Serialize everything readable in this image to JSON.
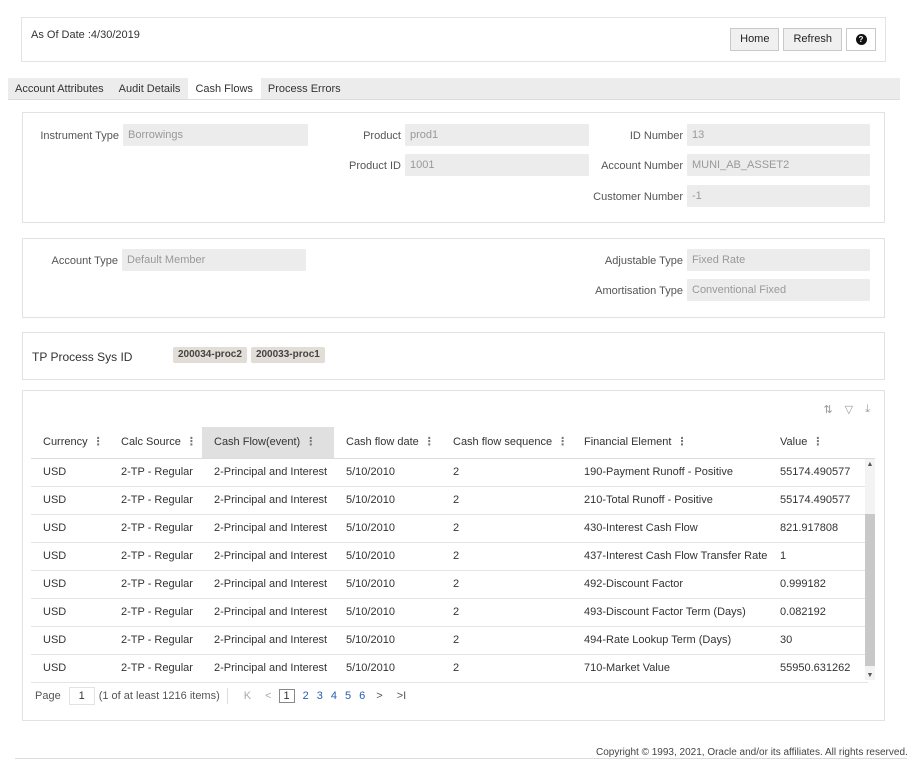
{
  "header": {
    "as_of": "As Of Date :4/30/2019",
    "home": "Home",
    "refresh": "Refresh",
    "help_glyph": "?"
  },
  "tabs": [
    {
      "label": "Account Attributes"
    },
    {
      "label": "Audit Details"
    },
    {
      "label": "Cash Flows"
    },
    {
      "label": "Process Errors"
    }
  ],
  "active_tab": "Cash Flows",
  "panel1": {
    "instrument_type_label": "Instrument Type",
    "instrument_type": "Borrowings",
    "product_label": "Product",
    "product": "prod1",
    "product_id_label": "Product ID",
    "product_id": "1001",
    "id_number_label": "ID Number",
    "id_number": "13",
    "account_number_label": "Account Number",
    "account_number": "MUNI_AB_ASSET2",
    "customer_number_label": "Customer Number",
    "customer_number": "-1"
  },
  "panel2": {
    "account_type_label": "Account Type",
    "account_type": "Default Member",
    "adjustable_type_label": "Adjustable Type",
    "adjustable_type": "Fixed Rate",
    "amortisation_type_label": "Amortisation Type",
    "amortisation_type": "Conventional Fixed"
  },
  "tp": {
    "label": "TP Process Sys ID",
    "chips": [
      "200034-proc2",
      "200033-proc1"
    ]
  },
  "grid": {
    "toolbar_icons": [
      "sort-icon",
      "filter-icon",
      "download-icon"
    ],
    "columns": [
      "Currency",
      "Calc Source",
      "Cash Flow(event)",
      "Cash flow date",
      "Cash flow sequence",
      "Financial Element",
      "Value"
    ],
    "selected_column": "Cash Flow(event)",
    "rows": [
      [
        "USD",
        "2-TP - Regular",
        "2-Principal and Interest",
        "5/10/2010",
        "2",
        "190-Payment Runoff - Positive",
        "55174.490577"
      ],
      [
        "USD",
        "2-TP - Regular",
        "2-Principal and Interest",
        "5/10/2010",
        "2",
        "210-Total Runoff - Positive",
        "55174.490577"
      ],
      [
        "USD",
        "2-TP - Regular",
        "2-Principal and Interest",
        "5/10/2010",
        "2",
        "430-Interest Cash Flow",
        "821.917808"
      ],
      [
        "USD",
        "2-TP - Regular",
        "2-Principal and Interest",
        "5/10/2010",
        "2",
        "437-Interest Cash Flow Transfer Rate",
        "1"
      ],
      [
        "USD",
        "2-TP - Regular",
        "2-Principal and Interest",
        "5/10/2010",
        "2",
        "492-Discount Factor",
        "0.999182"
      ],
      [
        "USD",
        "2-TP - Regular",
        "2-Principal and Interest",
        "5/10/2010",
        "2",
        "493-Discount Factor Term (Days)",
        "0.082192"
      ],
      [
        "USD",
        "2-TP - Regular",
        "2-Principal and Interest",
        "5/10/2010",
        "2",
        "494-Rate Lookup Term (Days)",
        "30"
      ],
      [
        "USD",
        "2-TP - Regular",
        "2-Principal and Interest",
        "5/10/2010",
        "2",
        "710-Market Value",
        "55950.631262"
      ]
    ]
  },
  "pager": {
    "page_label": "Page",
    "page_value": "1",
    "summary": "(1 of at least 1216 items)",
    "first": "K",
    "prev": "<",
    "pages": [
      "1",
      "2",
      "3",
      "4",
      "5",
      "6"
    ],
    "next": ">",
    "last": ">I"
  },
  "footer": "Copyright © 1993, 2021, Oracle and/or its affiliates. All rights reserved."
}
